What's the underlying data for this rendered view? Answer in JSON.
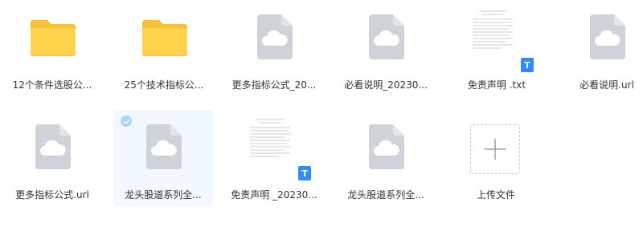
{
  "files": [
    {
      "label": "12个条件选股公...",
      "type": "folder",
      "icon": "folder-icon"
    },
    {
      "label": "25个技术指标公...",
      "type": "folder",
      "icon": "folder-icon"
    },
    {
      "label": "更多指标公式_20...",
      "type": "cloud",
      "icon": "cloud-file-icon"
    },
    {
      "label": "必看说明_20230...",
      "type": "cloud",
      "icon": "cloud-file-icon"
    },
    {
      "label": "免责声明 .txt",
      "type": "txt",
      "icon": "text-document-icon"
    },
    {
      "label": "必看说明.url",
      "type": "cloud",
      "icon": "cloud-file-icon"
    },
    {
      "label": "更多指标公式.url",
      "type": "cloud",
      "icon": "cloud-file-icon"
    },
    {
      "label": "龙头股道系列全...",
      "type": "cloud",
      "icon": "cloud-file-icon",
      "selected": true
    },
    {
      "label": "免责声明 _20230...",
      "type": "txt",
      "icon": "text-document-icon"
    },
    {
      "label": "龙头股道系列全...",
      "type": "cloud",
      "icon": "cloud-file-icon"
    }
  ],
  "upload": {
    "label": "上传文件",
    "icon": "plus-icon"
  },
  "badges": {
    "txt": "T"
  },
  "colors": {
    "folder": "#ffd24d",
    "folder_tab": "#f7c23a",
    "cloud_file": "#cfd2d8",
    "accent": "#2f8bff",
    "selected_bg": "#f1f8ff"
  }
}
